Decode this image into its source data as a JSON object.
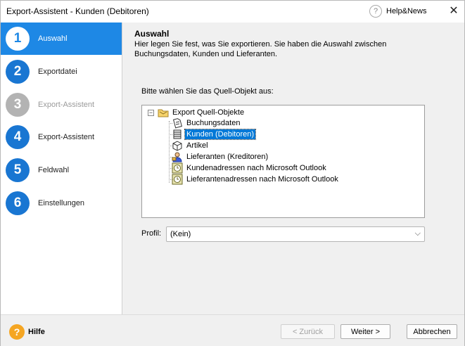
{
  "window": {
    "title": "Export-Assistent - Kunden (Debitoren)",
    "help_news": "Help&News",
    "help_news_icon": "question-icon",
    "close_icon": "close-icon",
    "close_glyph": "✕"
  },
  "accent_color": "#1e88e5",
  "steps": [
    {
      "num": "1",
      "label": "Auswahl",
      "state": "active"
    },
    {
      "num": "2",
      "label": "Exportdatei",
      "state": "normal"
    },
    {
      "num": "3",
      "label": "Export-Assistent",
      "state": "disabled"
    },
    {
      "num": "4",
      "label": "Export-Assistent",
      "state": "normal"
    },
    {
      "num": "5",
      "label": "Feldwahl",
      "state": "normal"
    },
    {
      "num": "6",
      "label": "Einstellungen",
      "state": "normal"
    }
  ],
  "header": {
    "title": "Auswahl",
    "description": "Hier legen Sie fest, was Sie exportieren. Sie haben die Auswahl zwischen Buchungsdaten, Kunden und Lieferanten."
  },
  "source": {
    "label": "Bitte wählen Sie das Quell-Objekt aus:",
    "expander": "−",
    "root": {
      "label": "Export Quell-Objekte",
      "icon": "folder-icon"
    },
    "items": [
      {
        "label": "Buchungsdaten",
        "icon": "document-icon",
        "selected": false
      },
      {
        "label": "Kunden (Debitoren)",
        "icon": "database-icon",
        "selected": true
      },
      {
        "label": "Artikel",
        "icon": "box-icon",
        "selected": false
      },
      {
        "label": "Lieferanten (Kreditoren)",
        "icon": "person-icon",
        "selected": false
      },
      {
        "label": "Kundenadressen nach Microsoft Outlook",
        "icon": "outlook-icon",
        "selected": false
      },
      {
        "label": "Lieferantenadressen nach Microsoft Outlook",
        "icon": "outlook-icon",
        "selected": false
      }
    ]
  },
  "profil": {
    "label": "Profil:",
    "value": "(Kein)",
    "chevron": "⌵"
  },
  "footer": {
    "help_label": "Hilfe",
    "help_glyph": "?",
    "back_label": "< Zurück",
    "next_label": "Weiter >",
    "cancel_label": "Abbrechen"
  }
}
